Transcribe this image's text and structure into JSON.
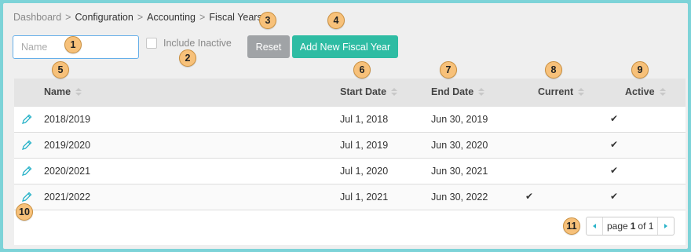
{
  "breadcrumb": {
    "items": [
      "Dashboard",
      "Configuration",
      "Accounting",
      "Fiscal Years"
    ],
    "separator": ">"
  },
  "filters": {
    "name_placeholder": "Name",
    "include_inactive_label": "Include Inactive",
    "include_inactive_checked": false
  },
  "buttons": {
    "reset": "Reset",
    "add_new": "Add New Fiscal Year"
  },
  "table": {
    "columns": [
      "Name",
      "Start Date",
      "End Date",
      "Current",
      "Active"
    ],
    "rows": [
      {
        "name": "2018/2019",
        "start": "Jul 1, 2018",
        "end": "Jun 30, 2019",
        "current": false,
        "active": true
      },
      {
        "name": "2019/2020",
        "start": "Jul 1, 2019",
        "end": "Jun 30, 2020",
        "current": false,
        "active": true
      },
      {
        "name": "2020/2021",
        "start": "Jul 1, 2020",
        "end": "Jun 30, 2021",
        "current": false,
        "active": true
      },
      {
        "name": "2021/2022",
        "start": "Jul 1, 2021",
        "end": "Jun 30, 2022",
        "current": true,
        "active": true
      }
    ]
  },
  "pagination": {
    "prefix": "page",
    "current": "1",
    "of": "of",
    "total": "1"
  },
  "callouts": [
    "1",
    "2",
    "3",
    "4",
    "5",
    "6",
    "7",
    "8",
    "9",
    "10",
    "11"
  ],
  "icons": {
    "edit": "pencil-icon",
    "check": "✔",
    "sort": "sort-icon"
  },
  "colors": {
    "frame_border": "#7dd3d8",
    "add_button": "#2ebca3",
    "reset_button": "#a0a3a6",
    "callout_fill": "#f7c17a",
    "accent": "#2ab3c9"
  }
}
